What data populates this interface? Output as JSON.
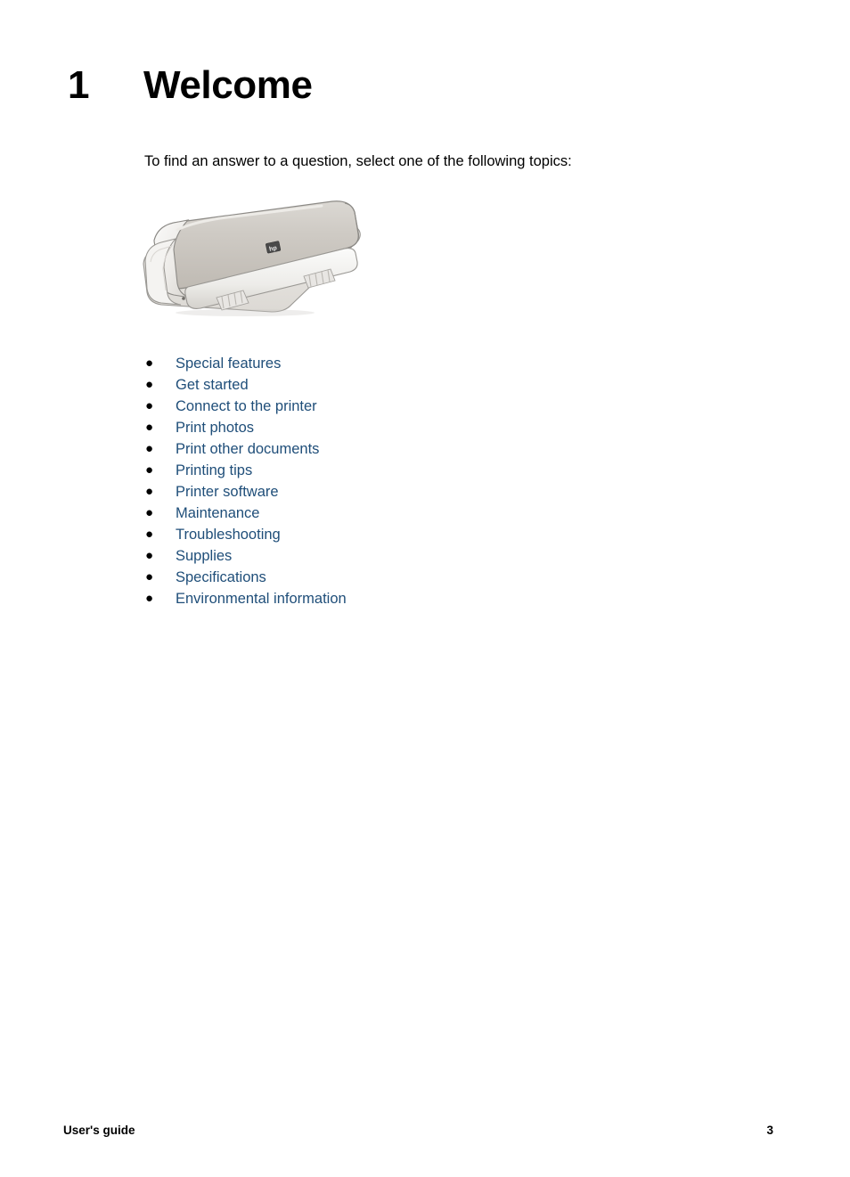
{
  "document": {
    "chapter_number": "1",
    "chapter_title": "Welcome",
    "intro_text": "To find an answer to a question, select one of the following topics:"
  },
  "figure": {
    "name": "hp-deskjet-printer-illustration",
    "alt": "HP Deskjet printer",
    "colors": {
      "body_grey": "#CECAC4",
      "body_grey_light": "#DEDBD6",
      "panel_white": "#F2F1EF",
      "outline": "#8C8A86",
      "logo_dark": "#3A3A3A"
    }
  },
  "topics": [
    {
      "label": "Special features"
    },
    {
      "label": "Get started"
    },
    {
      "label": "Connect to the printer"
    },
    {
      "label": "Print photos"
    },
    {
      "label": "Print other documents"
    },
    {
      "label": "Printing tips"
    },
    {
      "label": "Printer software"
    },
    {
      "label": "Maintenance"
    },
    {
      "label": "Troubleshooting"
    },
    {
      "label": "Supplies"
    },
    {
      "label": "Specifications"
    },
    {
      "label": "Environmental information"
    }
  ],
  "bullet_glyph": "●",
  "link_color": "#1F4E79",
  "footer": {
    "label": "User's guide",
    "page_number": "3"
  }
}
